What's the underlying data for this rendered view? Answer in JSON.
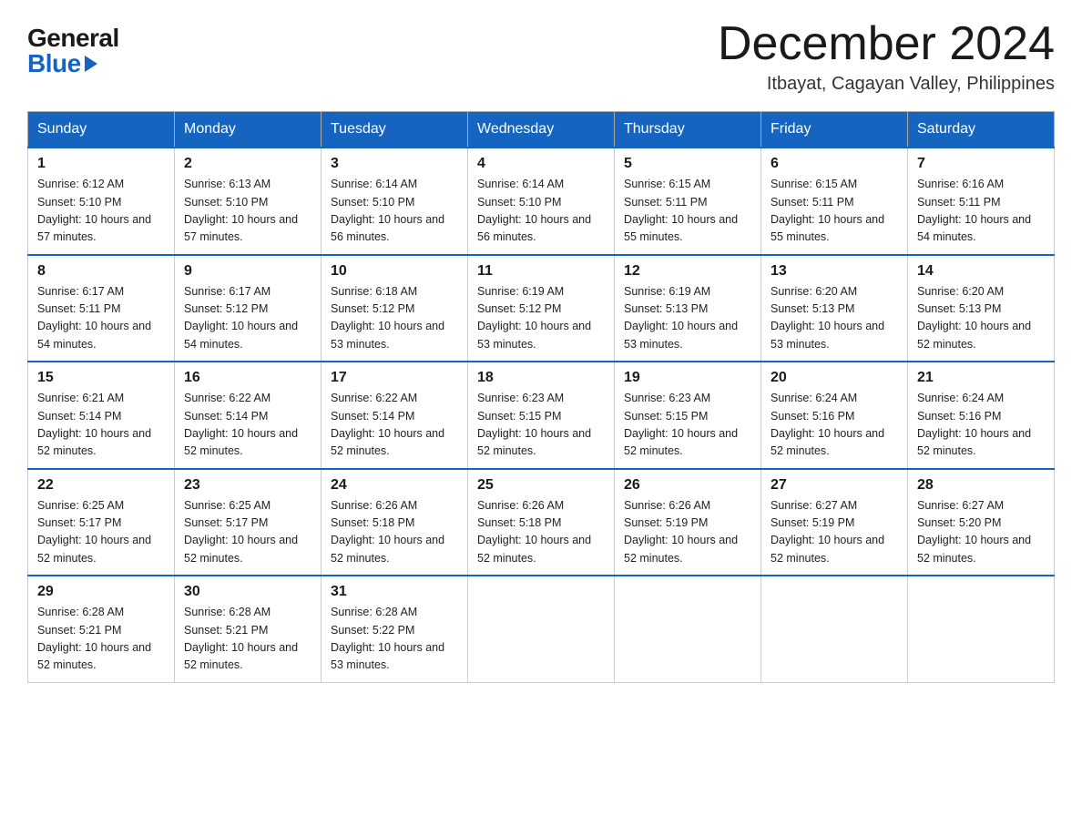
{
  "header": {
    "logo_general": "General",
    "logo_blue": "Blue",
    "month_title": "December 2024",
    "subtitle": "Itbayat, Cagayan Valley, Philippines"
  },
  "days_of_week": [
    "Sunday",
    "Monday",
    "Tuesday",
    "Wednesday",
    "Thursday",
    "Friday",
    "Saturday"
  ],
  "weeks": [
    {
      "days": [
        {
          "num": "1",
          "sunrise": "6:12 AM",
          "sunset": "5:10 PM",
          "daylight": "10 hours and 57 minutes."
        },
        {
          "num": "2",
          "sunrise": "6:13 AM",
          "sunset": "5:10 PM",
          "daylight": "10 hours and 57 minutes."
        },
        {
          "num": "3",
          "sunrise": "6:14 AM",
          "sunset": "5:10 PM",
          "daylight": "10 hours and 56 minutes."
        },
        {
          "num": "4",
          "sunrise": "6:14 AM",
          "sunset": "5:10 PM",
          "daylight": "10 hours and 56 minutes."
        },
        {
          "num": "5",
          "sunrise": "6:15 AM",
          "sunset": "5:11 PM",
          "daylight": "10 hours and 55 minutes."
        },
        {
          "num": "6",
          "sunrise": "6:15 AM",
          "sunset": "5:11 PM",
          "daylight": "10 hours and 55 minutes."
        },
        {
          "num": "7",
          "sunrise": "6:16 AM",
          "sunset": "5:11 PM",
          "daylight": "10 hours and 54 minutes."
        }
      ]
    },
    {
      "days": [
        {
          "num": "8",
          "sunrise": "6:17 AM",
          "sunset": "5:11 PM",
          "daylight": "10 hours and 54 minutes."
        },
        {
          "num": "9",
          "sunrise": "6:17 AM",
          "sunset": "5:12 PM",
          "daylight": "10 hours and 54 minutes."
        },
        {
          "num": "10",
          "sunrise": "6:18 AM",
          "sunset": "5:12 PM",
          "daylight": "10 hours and 53 minutes."
        },
        {
          "num": "11",
          "sunrise": "6:19 AM",
          "sunset": "5:12 PM",
          "daylight": "10 hours and 53 minutes."
        },
        {
          "num": "12",
          "sunrise": "6:19 AM",
          "sunset": "5:13 PM",
          "daylight": "10 hours and 53 minutes."
        },
        {
          "num": "13",
          "sunrise": "6:20 AM",
          "sunset": "5:13 PM",
          "daylight": "10 hours and 53 minutes."
        },
        {
          "num": "14",
          "sunrise": "6:20 AM",
          "sunset": "5:13 PM",
          "daylight": "10 hours and 52 minutes."
        }
      ]
    },
    {
      "days": [
        {
          "num": "15",
          "sunrise": "6:21 AM",
          "sunset": "5:14 PM",
          "daylight": "10 hours and 52 minutes."
        },
        {
          "num": "16",
          "sunrise": "6:22 AM",
          "sunset": "5:14 PM",
          "daylight": "10 hours and 52 minutes."
        },
        {
          "num": "17",
          "sunrise": "6:22 AM",
          "sunset": "5:14 PM",
          "daylight": "10 hours and 52 minutes."
        },
        {
          "num": "18",
          "sunrise": "6:23 AM",
          "sunset": "5:15 PM",
          "daylight": "10 hours and 52 minutes."
        },
        {
          "num": "19",
          "sunrise": "6:23 AM",
          "sunset": "5:15 PM",
          "daylight": "10 hours and 52 minutes."
        },
        {
          "num": "20",
          "sunrise": "6:24 AM",
          "sunset": "5:16 PM",
          "daylight": "10 hours and 52 minutes."
        },
        {
          "num": "21",
          "sunrise": "6:24 AM",
          "sunset": "5:16 PM",
          "daylight": "10 hours and 52 minutes."
        }
      ]
    },
    {
      "days": [
        {
          "num": "22",
          "sunrise": "6:25 AM",
          "sunset": "5:17 PM",
          "daylight": "10 hours and 52 minutes."
        },
        {
          "num": "23",
          "sunrise": "6:25 AM",
          "sunset": "5:17 PM",
          "daylight": "10 hours and 52 minutes."
        },
        {
          "num": "24",
          "sunrise": "6:26 AM",
          "sunset": "5:18 PM",
          "daylight": "10 hours and 52 minutes."
        },
        {
          "num": "25",
          "sunrise": "6:26 AM",
          "sunset": "5:18 PM",
          "daylight": "10 hours and 52 minutes."
        },
        {
          "num": "26",
          "sunrise": "6:26 AM",
          "sunset": "5:19 PM",
          "daylight": "10 hours and 52 minutes."
        },
        {
          "num": "27",
          "sunrise": "6:27 AM",
          "sunset": "5:19 PM",
          "daylight": "10 hours and 52 minutes."
        },
        {
          "num": "28",
          "sunrise": "6:27 AM",
          "sunset": "5:20 PM",
          "daylight": "10 hours and 52 minutes."
        }
      ]
    },
    {
      "days": [
        {
          "num": "29",
          "sunrise": "6:28 AM",
          "sunset": "5:21 PM",
          "daylight": "10 hours and 52 minutes."
        },
        {
          "num": "30",
          "sunrise": "6:28 AM",
          "sunset": "5:21 PM",
          "daylight": "10 hours and 52 minutes."
        },
        {
          "num": "31",
          "sunrise": "6:28 AM",
          "sunset": "5:22 PM",
          "daylight": "10 hours and 53 minutes."
        },
        null,
        null,
        null,
        null
      ]
    }
  ]
}
